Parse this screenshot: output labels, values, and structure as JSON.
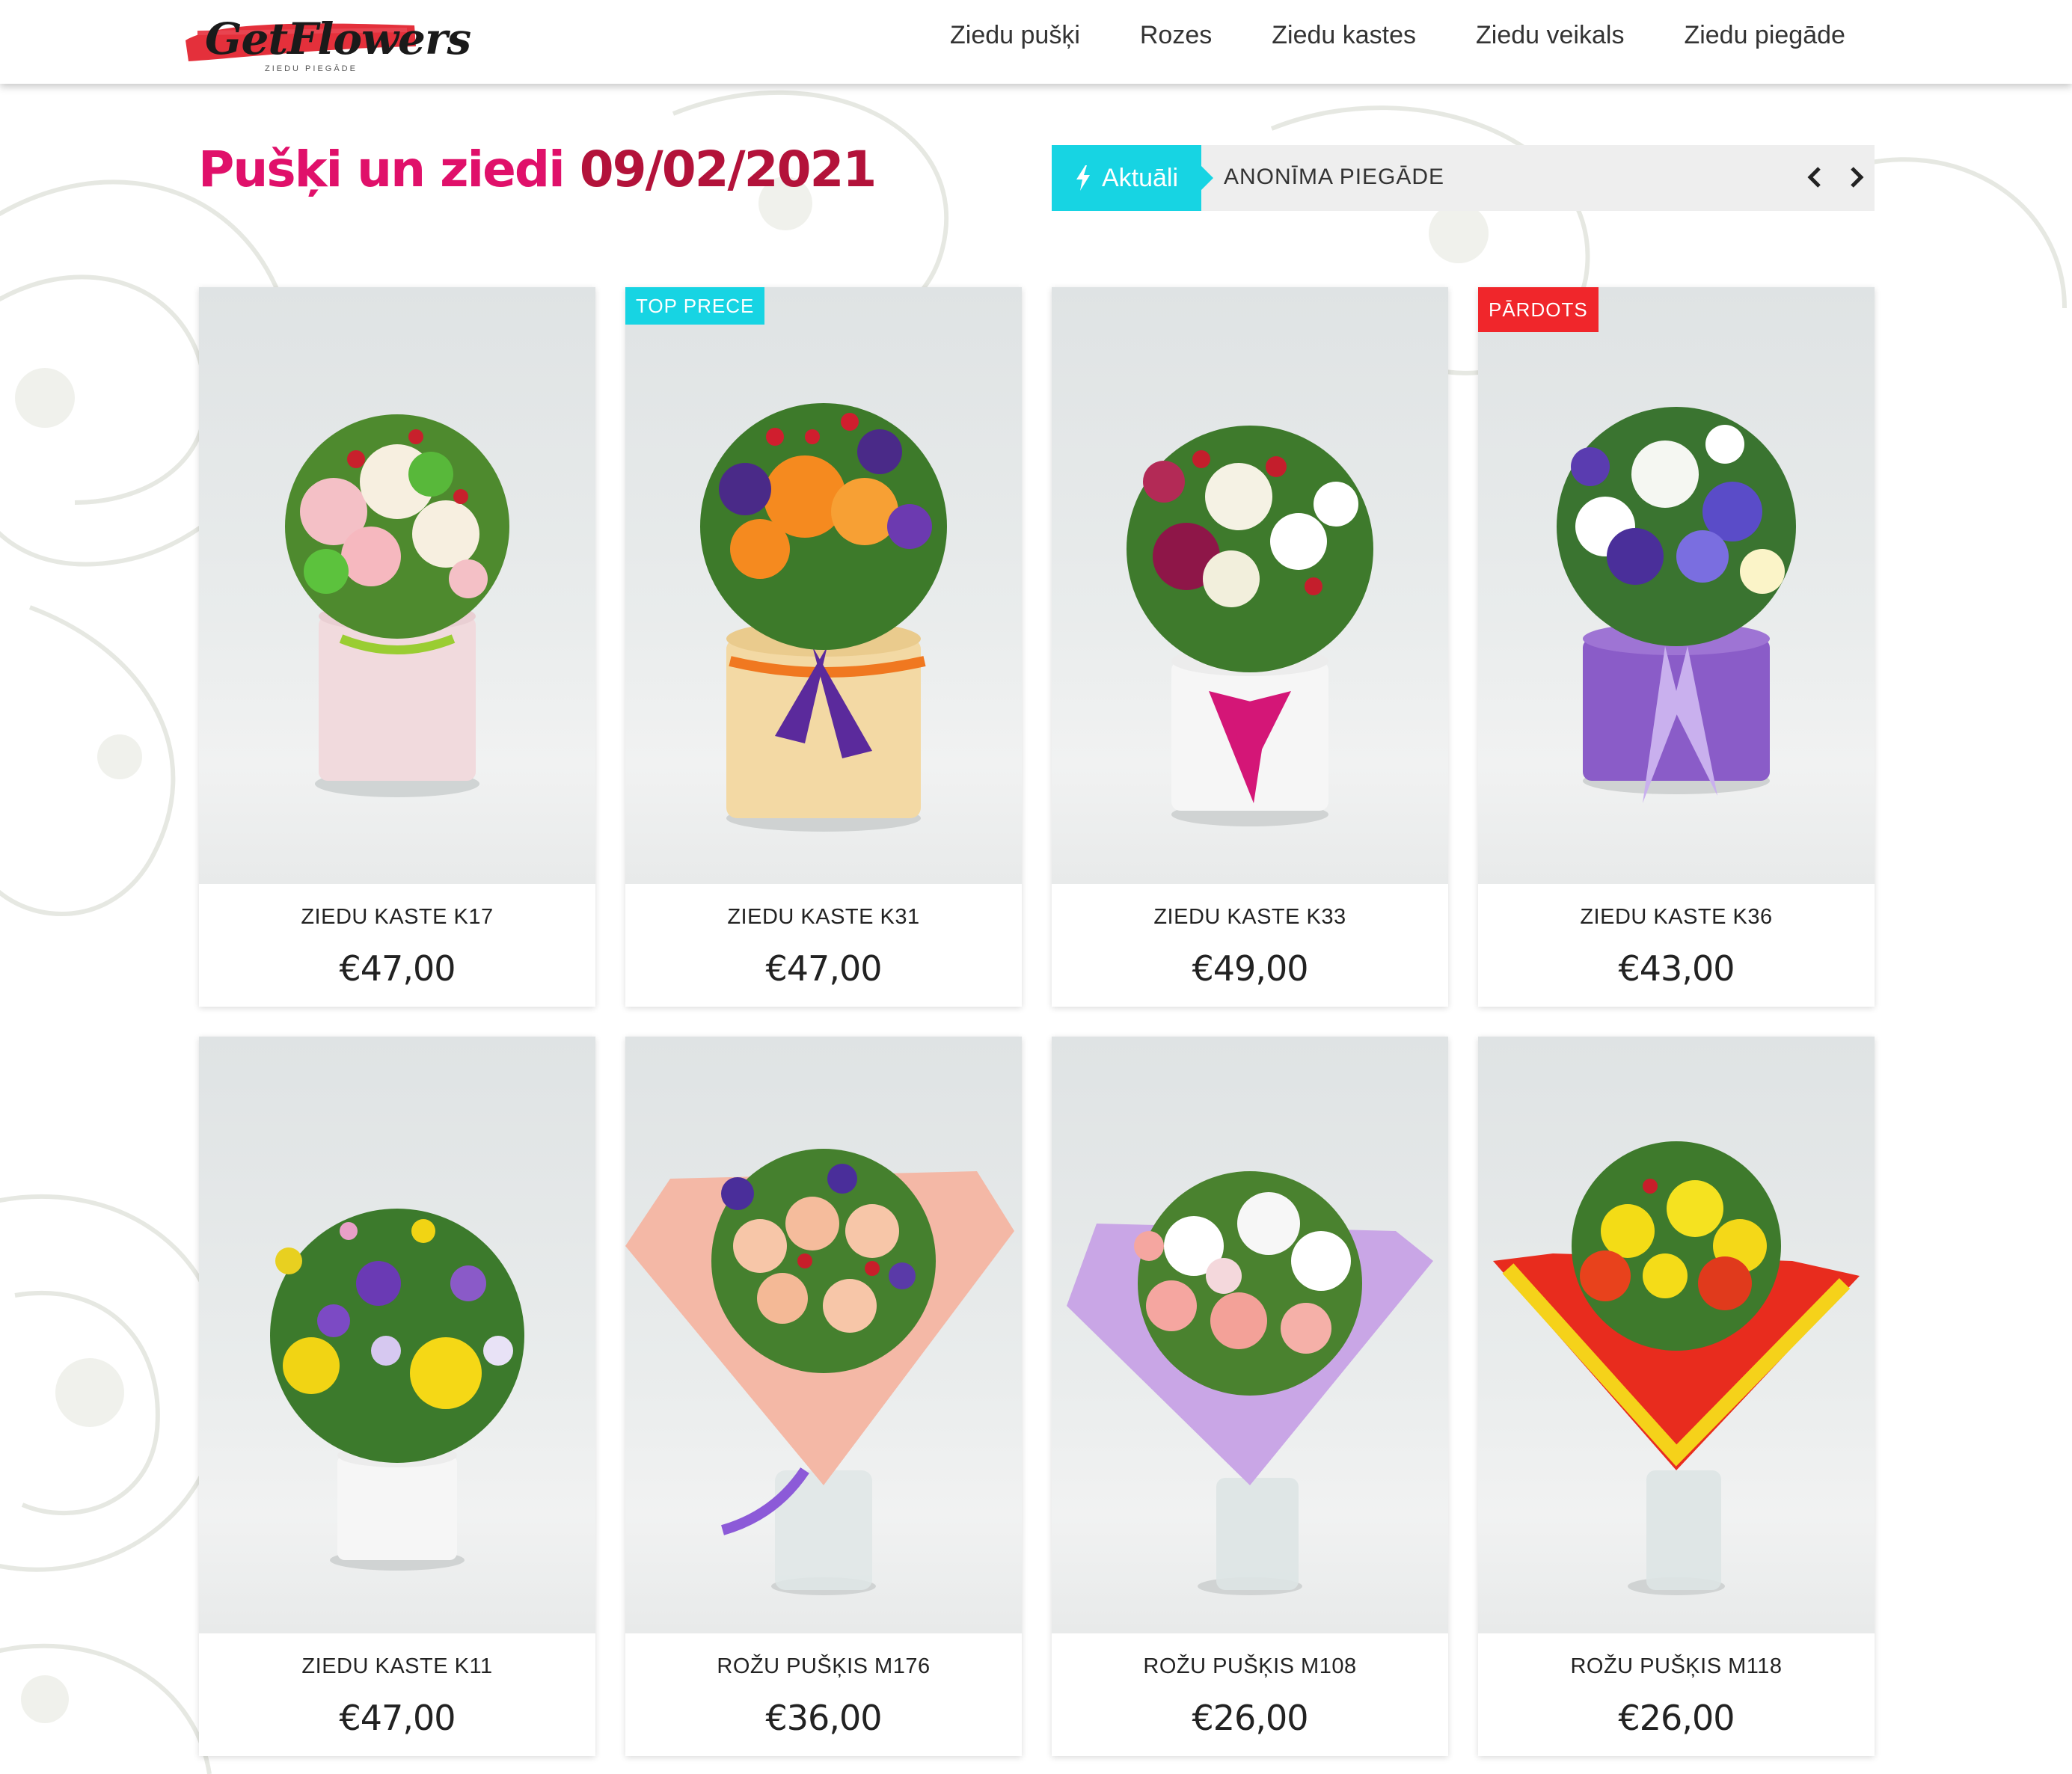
{
  "header": {
    "logo": {
      "text": "GetFlowers",
      "tagline": "ZIEDU PIEGĀDE"
    },
    "nav": [
      {
        "label": "Ziedu pušķi"
      },
      {
        "label": "Rozes"
      },
      {
        "label": "Ziedu kastes"
      },
      {
        "label": "Ziedu veikals"
      },
      {
        "label": "Ziedu piegāde"
      }
    ]
  },
  "page": {
    "title_prefix": "Pušķi un ziedi",
    "title_date": "09/02/2021"
  },
  "ticker": {
    "label": "Aktuāli",
    "label_icon": "lightning-icon",
    "text": "ANONĪMA PIEGĀDE",
    "prev_icon": "chevron-left-icon",
    "next_icon": "chevron-right-icon"
  },
  "products": [
    {
      "name": "ZIEDU KASTE K17",
      "price": "€47,00",
      "badge": ""
    },
    {
      "name": "ZIEDU KASTE K31",
      "price": "€47,00",
      "badge": "TOP PRECE"
    },
    {
      "name": "ZIEDU KASTE K33",
      "price": "€49,00",
      "badge": ""
    },
    {
      "name": "ZIEDU KASTE K36",
      "price": "€43,00",
      "badge": "PĀRDOTS"
    },
    {
      "name": "ZIEDU KASTE K11",
      "price": "€47,00",
      "badge": ""
    },
    {
      "name": "ROŽU PUŠĶIS M176",
      "price": "€36,00",
      "badge": ""
    },
    {
      "name": "ROŽU PUŠĶIS M108",
      "price": "€26,00",
      "badge": ""
    },
    {
      "name": "ROŽU PUŠĶIS M118",
      "price": "€26,00",
      "badge": ""
    }
  ],
  "colors": {
    "title_pink": "#e0106a",
    "title_date": "#b3123a",
    "accent_cyan": "#17d4e3",
    "sold_red": "#f0262b"
  }
}
